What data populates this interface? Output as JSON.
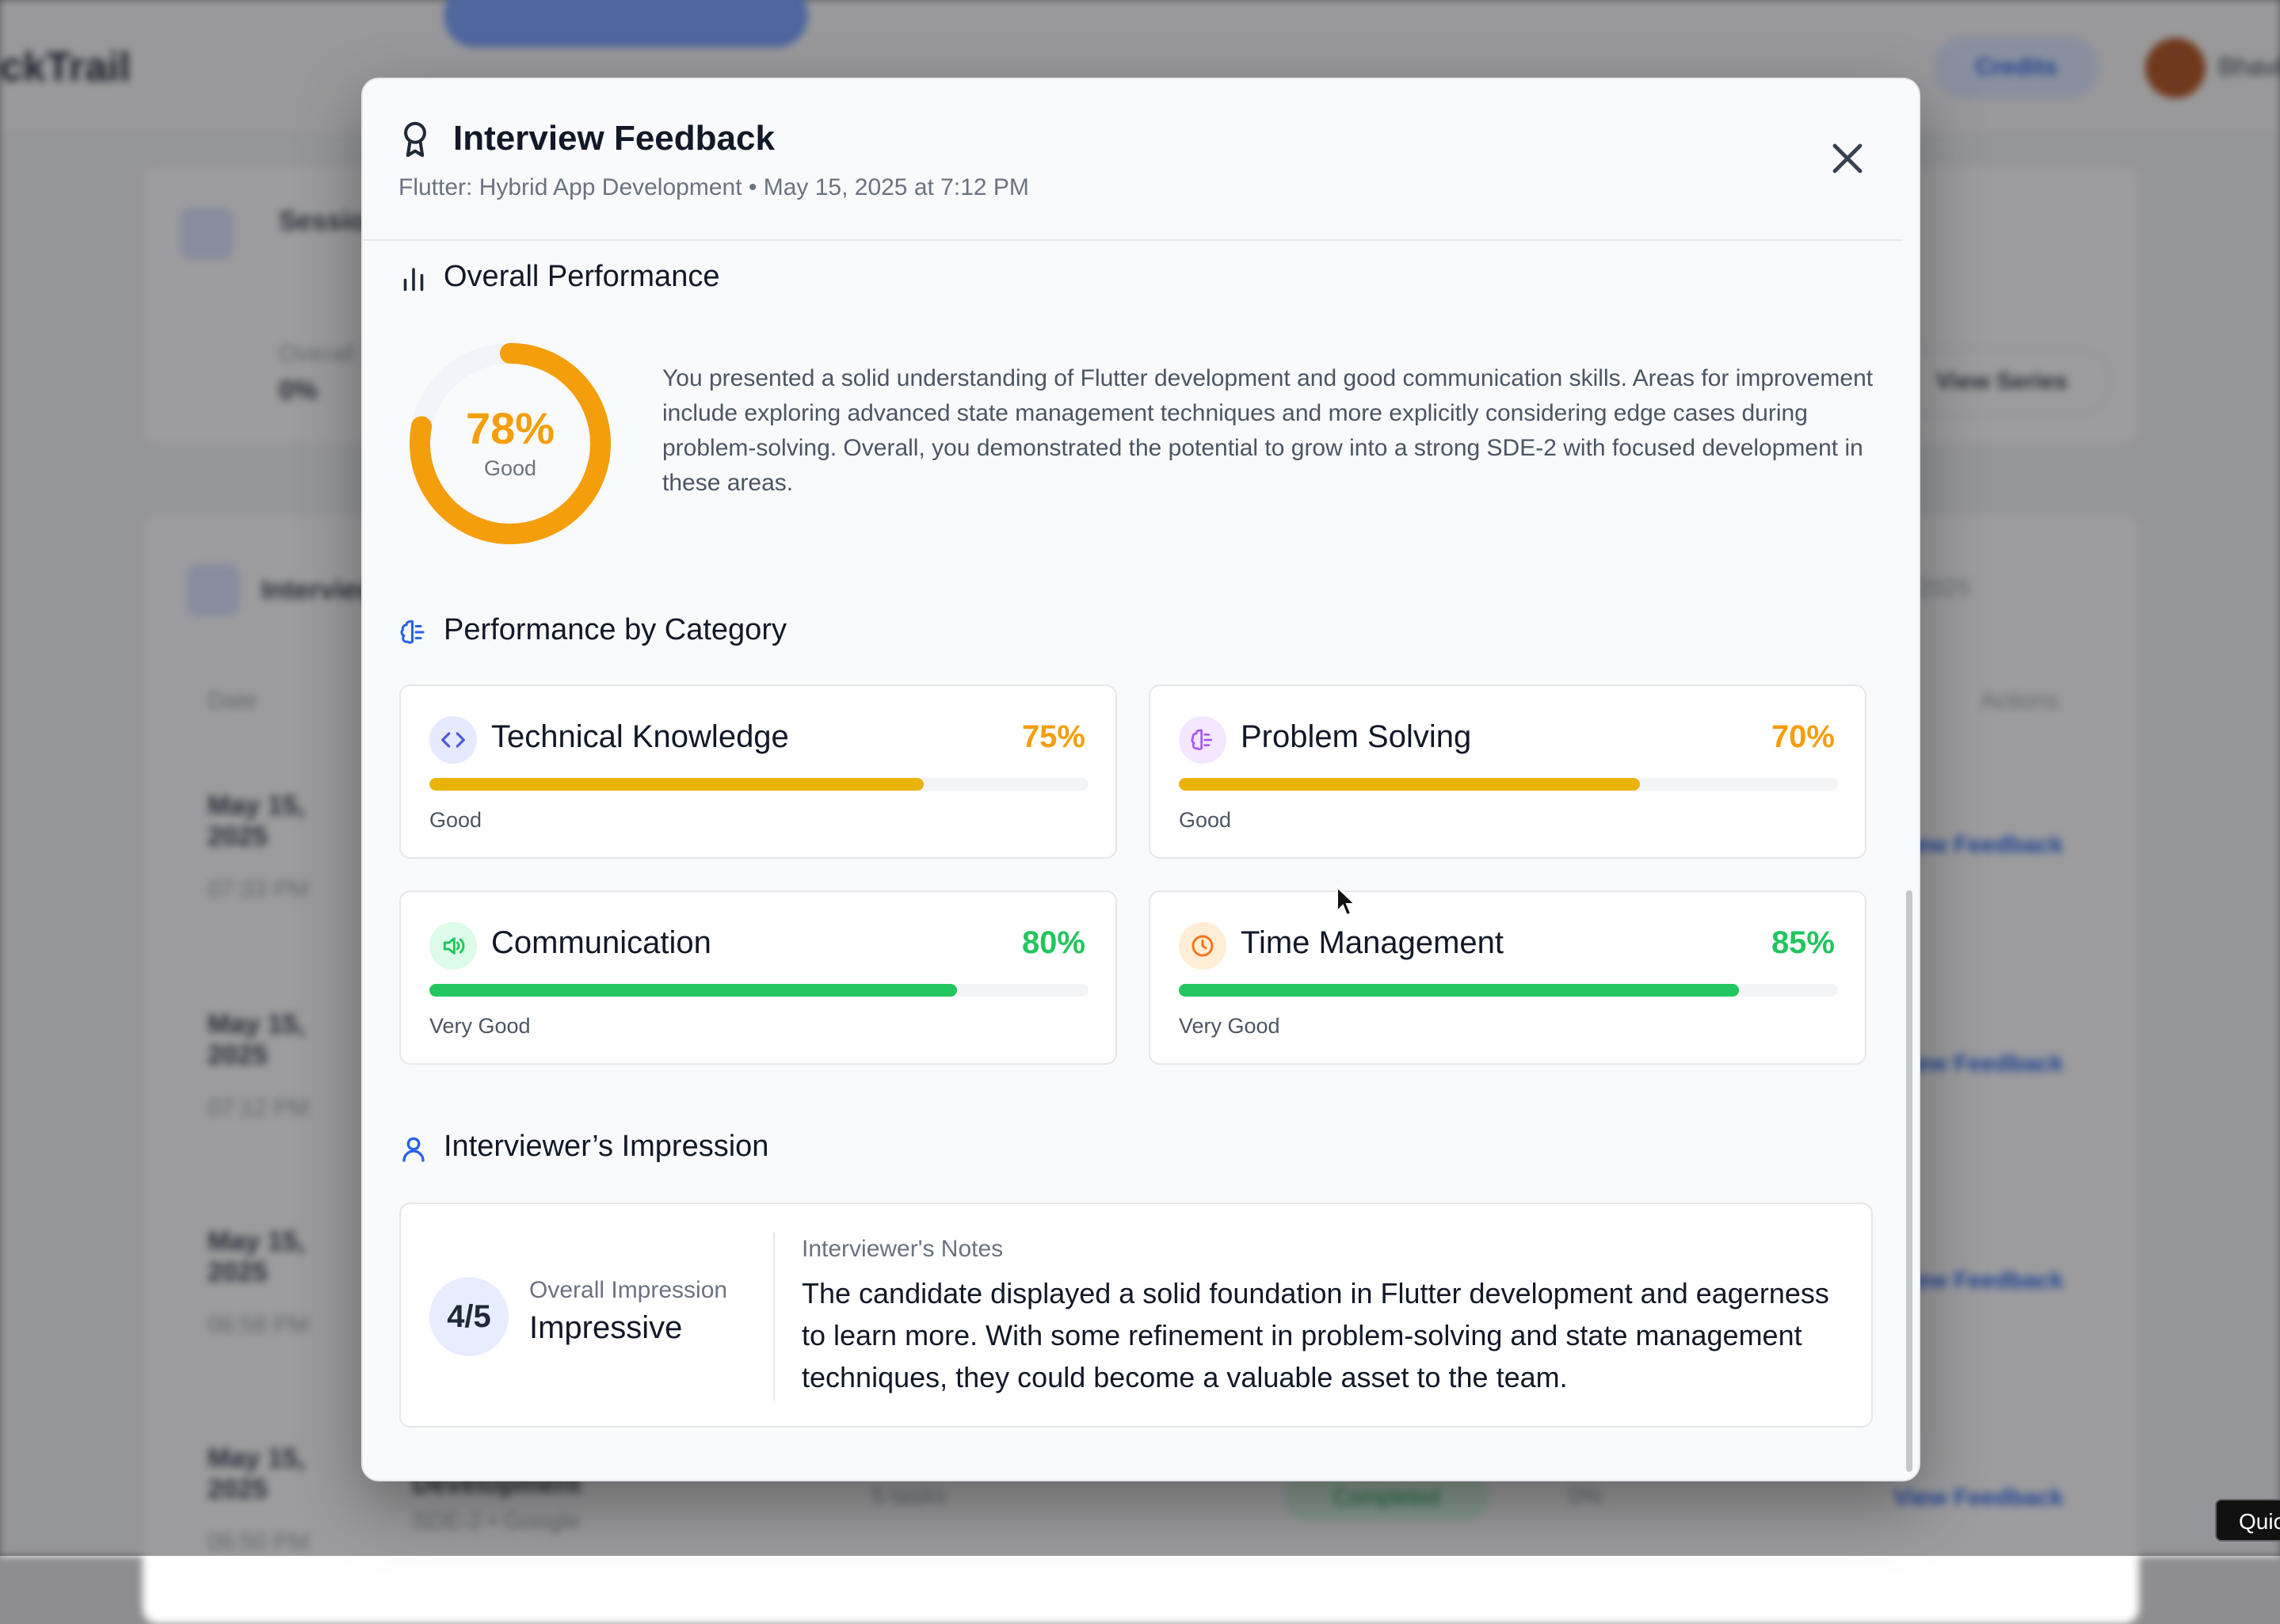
{
  "background": {
    "logo": "ckTrail",
    "credits": "Credits",
    "user_name": "Bhavik",
    "card1_title": "Session",
    "card1_label": "Overall",
    "card1_value": "0%",
    "view_series_button": "View Series",
    "card2_title": "Interviews",
    "date_filter": "2025",
    "col_date": "Date",
    "col_actions": "Actions",
    "rows": [
      {
        "date": "May 15, 2025",
        "time": "07:33 PM",
        "action": "View Feedback"
      },
      {
        "date": "May 15, 2025",
        "time": "07:12 PM",
        "action": "View Feedback"
      },
      {
        "date": "May 15, 2025",
        "time": "06:58 PM",
        "action": "View Feedback"
      },
      {
        "date": "May 15, 2025",
        "time": "06:50 PM",
        "action": "View Feedback",
        "title": "Development",
        "sub": "SDE-2 • Google",
        "questions": "5 tasks",
        "status": "Completed",
        "score": "0%"
      }
    ]
  },
  "modal": {
    "title": "Interview Feedback",
    "subtitle": "Flutter: Hybrid App Development • May 15, 2025 at 7:12 PM",
    "overall": {
      "heading": "Overall Performance",
      "score_text": "78%",
      "score_value": 78,
      "rating": "Good",
      "summary": "You presented a solid understanding of Flutter development and good communication skills. Areas for improvement include exploring advanced state management techniques and more explicitly considering edge cases during problem-solving. Overall, you demonstrated the potential to grow into a strong SDE-2 with focused development in these areas.",
      "color": "#f59e0b"
    },
    "categories_heading": "Performance by Category",
    "categories": [
      {
        "name": "Technical Knowledge",
        "score_text": "75%",
        "score": 75,
        "level": "Good",
        "icon": "code-icon",
        "icon_bg": "#e5eaff",
        "icon_color": "#4f5bd5",
        "bar_color": "#eab308",
        "score_color": "#f59e0b"
      },
      {
        "name": "Problem Solving",
        "score_text": "70%",
        "score": 70,
        "level": "Good",
        "icon": "brain-icon",
        "icon_bg": "#f3e8ff",
        "icon_color": "#a855f7",
        "bar_color": "#eab308",
        "score_color": "#f59e0b"
      },
      {
        "name": "Communication",
        "score_text": "80%",
        "score": 80,
        "level": "Very Good",
        "icon": "speaker-icon",
        "icon_bg": "#dcfce7",
        "icon_color": "#22c55e",
        "bar_color": "#22c55e",
        "score_color": "#22c55e"
      },
      {
        "name": "Time Management",
        "score_text": "85%",
        "score": 85,
        "level": "Very Good",
        "icon": "clock-icon",
        "icon_bg": "#ffedd5",
        "icon_color": "#f97316",
        "bar_color": "#22c55e",
        "score_color": "#22c55e"
      }
    ],
    "impression": {
      "heading": "Interviewer’s Impression",
      "rating": "4/5",
      "overall_label": "Overall Impression",
      "overall_value": "Impressive",
      "notes_label": "Interviewer's Notes",
      "notes": "The candidate displayed a solid foundation in Flutter development and eagerness to learn more. With some refinement in problem-solving and state management techniques, they could become a valuable asset to the team."
    }
  },
  "quick_button": "Quick"
}
